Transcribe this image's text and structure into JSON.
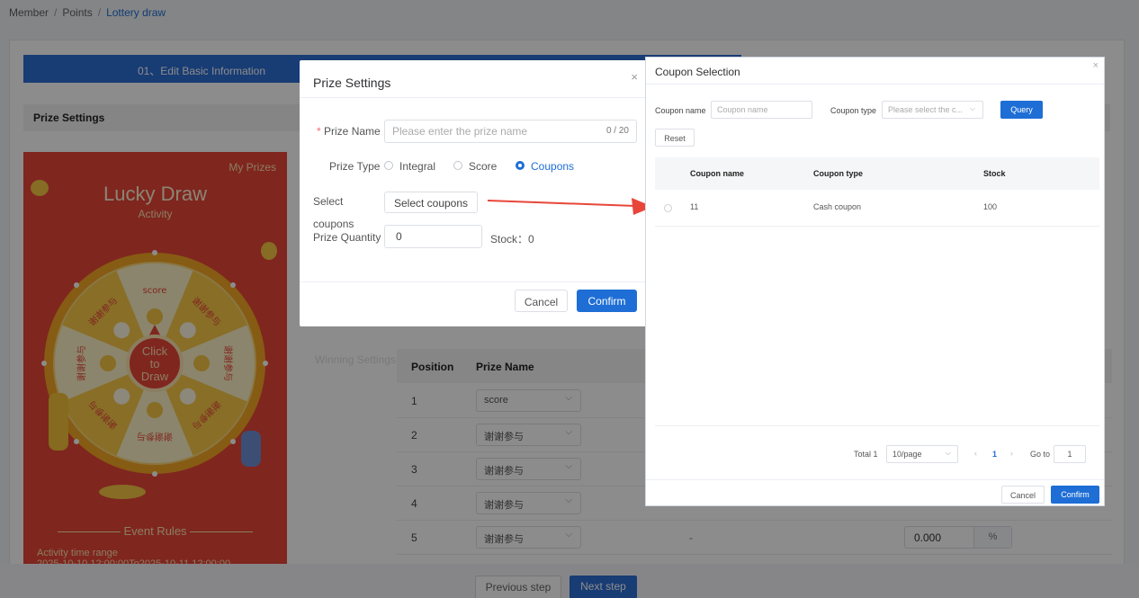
{
  "breadcrumb": {
    "b1": "Member",
    "b2": "Points",
    "b3": "Lottery draw",
    "sep": "/"
  },
  "steps": {
    "step1": "01、Edit Basic Information"
  },
  "section": {
    "prize_settings": "Prize Settings"
  },
  "phone": {
    "my_prizes": "My Prizes",
    "lucky": "Lucky Draw",
    "activity": "Activity",
    "wheel_center": "Click to Draw",
    "segments": [
      "score",
      "谢谢参与",
      "谢谢参与",
      "谢谢参与",
      "谢谢参与",
      "谢谢参与",
      "谢谢参与",
      "谢谢参与"
    ],
    "rules": "Event Rules",
    "range_label": "Activity time range",
    "range_value": "2025-10-10 12:00:00To2025-10-11 12:00:00"
  },
  "winning": {
    "label": "Winning Settings",
    "col_position": "Position",
    "col_prize": "Prize Name",
    "rows": [
      {
        "pos": "1",
        "prize": "score"
      },
      {
        "pos": "2",
        "prize": "谢谢参与"
      },
      {
        "pos": "3",
        "prize": "谢谢参与"
      },
      {
        "pos": "4",
        "prize": "谢谢参与"
      },
      {
        "pos": "5",
        "prize": "谢谢参与",
        "dash": "-",
        "pct": "0.000",
        "unit": "%"
      }
    ]
  },
  "footer": {
    "prev": "Previous step",
    "next": "Next step"
  },
  "prize_dialog": {
    "title": "Prize Settings",
    "close": "×",
    "req": "*",
    "prize_name_label": "Prize Name",
    "prize_name_placeholder": "Please enter the prize name",
    "prize_name_count": "0 / 20",
    "prize_type_label": "Prize Type",
    "types": [
      "Integral",
      "Score",
      "Coupons"
    ],
    "selected_type": "Coupons",
    "select_label": "Select",
    "coupons_label": "coupons",
    "select_btn": "Select coupons",
    "qty_label": "Prize Quantity",
    "qty_value": "0",
    "stock": "Stock：0",
    "cancel": "Cancel",
    "confirm": "Confirm"
  },
  "coupon_dialog": {
    "title": "Coupon Selection",
    "close": "×",
    "name_label": "Coupon name",
    "name_placeholder": "Coupon name",
    "type_label": "Coupon type",
    "type_placeholder": "Please select the c...",
    "query": "Query",
    "reset": "Reset",
    "col_name": "Coupon name",
    "col_type": "Coupon type",
    "col_stock": "Stock",
    "rows": [
      {
        "name": "11",
        "type": "Cash coupon",
        "stock": "100"
      }
    ],
    "total": "Total 1",
    "page_size": "10/page",
    "page": "1",
    "goto_label": "Go to",
    "goto_value": "1",
    "cancel": "Cancel",
    "confirm": "Confirm"
  },
  "colors": {
    "primary": "#1e6ed6",
    "phone_bg": "#e8463a",
    "wheel": "#f5c542",
    "arrow": "#e8463a"
  }
}
